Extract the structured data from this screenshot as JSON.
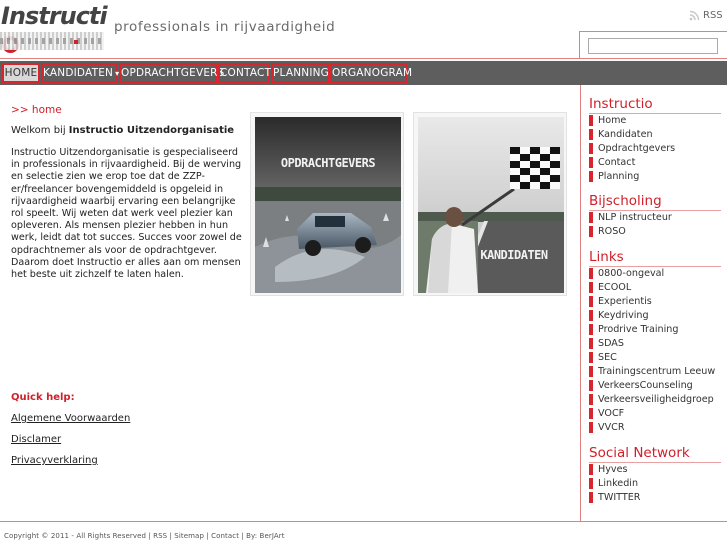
{
  "brand": {
    "logo_text": "Instructi",
    "tagline": "professionals in rijvaardigheid"
  },
  "header": {
    "rss_label": "RSS",
    "search": {
      "value": "",
      "placeholder": ""
    }
  },
  "nav": {
    "items": [
      {
        "label": "HOME",
        "active": true
      },
      {
        "label": "KANDIDATEN",
        "has_dropdown": true
      },
      {
        "label": "OPDRACHTGEVERS"
      },
      {
        "label": "CONTACT"
      },
      {
        "label": "PLANNING"
      },
      {
        "label": "ORGANOGRAM"
      }
    ],
    "dropdown_glyph": "▾"
  },
  "main": {
    "breadcrumb": ">> home",
    "welcome_prefix": "Welkom bij ",
    "welcome_bold": "Instructio Uitzendorganisatie",
    "intro": "Instructio Uitzendorganisatie is gespecialiseerd in professionals in rijvaardigheid. Bij de werving en selectie zien we erop toe dat de ZZP-er/freelancer bovengemiddeld is opgeleid in rijvaardigheid waarbij ervaring een belangrijke rol speelt. Wij weten dat werk veel plezier kan opleveren. Als mensen plezier hebben in hun werk, leidt dat tot succes. Succes voor zowel de opdrachtnemer als voor de opdrachtgever. Daarom doet Instructio er alles aan om mensen het beste uit zichzelf te laten halen.",
    "promos": [
      {
        "label": "OPDRACHTGEVERS"
      },
      {
        "label": "KANDIDATEN"
      }
    ],
    "quick_help": {
      "title": "Quick help:",
      "links": [
        "Algemene Voorwaarden ",
        "Disclamer",
        "Privacyverklaring"
      ]
    }
  },
  "sidebar": {
    "sections": [
      {
        "title": "Instructio",
        "items": [
          "Home",
          "Kandidaten",
          "Opdrachtgevers",
          "Contact",
          "Planning"
        ]
      },
      {
        "title": "Bijscholing",
        "items": [
          "NLP instructeur",
          "ROSO"
        ]
      },
      {
        "title": "Links",
        "items": [
          "0800-ongeval",
          "ECOOL",
          "Experientis",
          "Keydriving",
          "Prodrive Training",
          "SDAS",
          "SEC",
          "Trainingscentrum Leeuw",
          "VerkeersCounseling",
          "Verkeersveiligheidgroep",
          "VOCF",
          "VVCR"
        ]
      },
      {
        "title": "Social Network",
        "items": [
          "Hyves",
          "Linkedin",
          "TWITTER"
        ]
      }
    ]
  },
  "footer": {
    "text": "Copyright © 2011 - All Rights Reserved | RSS | Sitemap | Contact | By: BerJArt"
  },
  "colors": {
    "accent": "#d0202a",
    "nav_bg": "#5e5e5e",
    "nav_border": "#d6252d",
    "divider": "#e08080"
  },
  "icons": {
    "rss": "rss-icon",
    "dropdown": "chevron-down-icon"
  }
}
